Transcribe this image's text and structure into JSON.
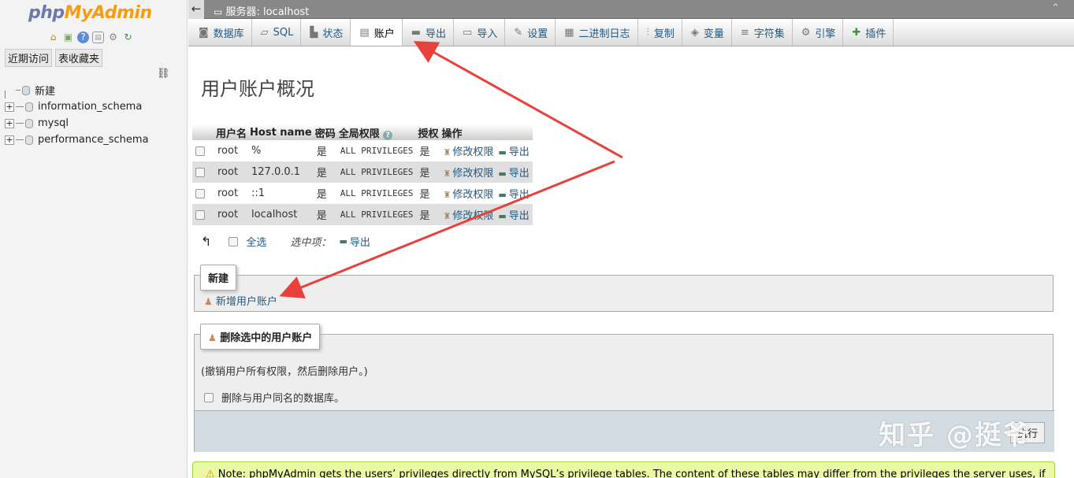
{
  "nav": {
    "logo_php": "php",
    "logo_myadmin": "MyAdmin",
    "icons": [
      "home-icon",
      "exit-icon",
      "help-icon",
      "docs-icon",
      "settings-icon",
      "reload-icon"
    ],
    "tab_recent": "近期访问",
    "tab_favorites": "表收藏夹",
    "tree": [
      "新建",
      "information_schema",
      "mysql",
      "performance_schema"
    ]
  },
  "topbar": {
    "server": "服务器: localhost"
  },
  "menu": [
    {
      "label": "数据库",
      "icon": "database-icon"
    },
    {
      "label": "SQL",
      "icon": "sql-icon"
    },
    {
      "label": "状态",
      "icon": "status-icon"
    },
    {
      "label": "账户",
      "icon": "accounts-icon"
    },
    {
      "label": "导出",
      "icon": "export-icon"
    },
    {
      "label": "导入",
      "icon": "import-icon"
    },
    {
      "label": "设置",
      "icon": "wrench-icon"
    },
    {
      "label": "二进制日志",
      "icon": "binlog-icon"
    },
    {
      "label": "复制",
      "icon": "replication-icon"
    },
    {
      "label": "变量",
      "icon": "variables-icon"
    },
    {
      "label": "字符集",
      "icon": "charset-icon"
    },
    {
      "label": "引擎",
      "icon": "engine-icon"
    },
    {
      "label": "插件",
      "icon": "plugin-icon"
    }
  ],
  "page_title": "用户账户概况",
  "table": {
    "headers": [
      "用户名",
      "Host name",
      "密码",
      "全局权限",
      "授权",
      "操作"
    ],
    "rows": [
      {
        "user": "root",
        "host": "%",
        "password": "是",
        "privileges": "ALL PRIVILEGES",
        "grant": "是",
        "edit": "修改权限",
        "export": "导出"
      },
      {
        "user": "root",
        "host": "127.0.0.1",
        "password": "是",
        "privileges": "ALL PRIVILEGES",
        "grant": "是",
        "edit": "修改权限",
        "export": "导出"
      },
      {
        "user": "root",
        "host": "::1",
        "password": "是",
        "privileges": "ALL PRIVILEGES",
        "grant": "是",
        "edit": "修改权限",
        "export": "导出"
      },
      {
        "user": "root",
        "host": "localhost",
        "password": "是",
        "privileges": "ALL PRIVILEGES",
        "grant": "是",
        "edit": "修改权限",
        "export": "导出"
      }
    ]
  },
  "selection": {
    "check_all": "全选",
    "with_selected": "选中项：",
    "export": "导出"
  },
  "new_section": {
    "legend": "新建",
    "add_user": "新增用户账户"
  },
  "delete_section": {
    "legend": "删除选中的用户账户",
    "note": "(撤销用户所有权限，然后删除用户。)",
    "drop_db_option": "删除与用户同名的数据库。",
    "go_button": "执行"
  },
  "notice": "Note: phpMyAdmin gets the users’ privileges directly from MySQL’s privilege tables. The content of these tables may differ from the privileges the server uses, if",
  "watermark": "知乎 @挺爷",
  "colors": {
    "link": "#235a81",
    "annotation_arrow": "#e8413c",
    "notice_bg": "#ebf8a4"
  }
}
